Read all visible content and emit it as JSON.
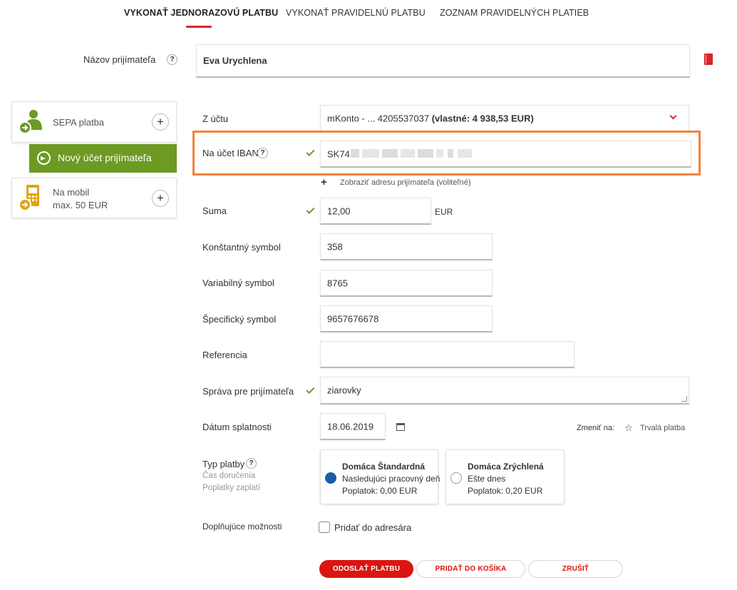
{
  "tabs": [
    {
      "label": "VYKONAŤ JEDNORAZOVÚ PLATBU",
      "active": true
    },
    {
      "label": "VYKONAŤ PRAVIDELNÚ PLATBU",
      "active": false
    },
    {
      "label": "ZOZNAM PRAVIDELNÝCH PLATIEB",
      "active": false
    }
  ],
  "recipient": {
    "label": "Názov prijímateľa",
    "value": "Eva Urychlena",
    "help": "?"
  },
  "sidebar": {
    "sepa": {
      "label": "SEPA platba",
      "icon": "person-payment-icon"
    },
    "new_account": {
      "label": "Nový účet prijímateľa"
    },
    "mobile": {
      "line1": "Na mobil",
      "line2": "max. 50 EUR",
      "icon": "mobile-payment-icon"
    },
    "plus": "+"
  },
  "form": {
    "from_account": {
      "label": "Z účtu",
      "value_prefix": "mKonto - ... 4205537037 ",
      "value_bold": "(vlastné: 4 938,53 EUR)"
    },
    "iban": {
      "label": "Na účet IBAN",
      "value": "SK74"
    },
    "show_address": {
      "plus": "+",
      "label": "Zobraziť adresu prijímateľa (voliteľné)"
    },
    "amount": {
      "label": "Suma",
      "value": "12,00",
      "currency": "EUR"
    },
    "constant_symbol": {
      "label": "Konštantný symbol",
      "value": "358"
    },
    "variable_symbol": {
      "label": "Variabilný symbol",
      "value": "8765"
    },
    "specific_symbol": {
      "label": "Špecifický symbol",
      "value": "9657676678"
    },
    "reference": {
      "label": "Referencia",
      "value": ""
    },
    "message": {
      "label": "Správa pre prijímateľa",
      "value": "ziarovky"
    },
    "due_date": {
      "label": "Dátum splatnosti",
      "value": "18.06.2019"
    },
    "change_to": {
      "label": "Zmeniť na:",
      "option": "Trvalá platba"
    },
    "payment_type": {
      "label": "Typ platby",
      "sub1": "Čas doručenia",
      "sub2": "Poplatky zaplatí",
      "options": [
        {
          "title": "Domáca Štandardná",
          "line2": "Nasledujúci pracovný deň",
          "line3": "Poplatok: 0,00 EUR",
          "selected": true
        },
        {
          "title": "Domáca Zrýchlená",
          "line2": "Ešte dnes",
          "line3": "Poplatok: 0,20 EUR",
          "selected": false
        }
      ]
    },
    "extra": {
      "label": "Doplňujúce možnosti",
      "checkbox_label": "Pridať do adresára"
    }
  },
  "buttons": {
    "send": "ODOSLAŤ PLATBU",
    "add_cart": "PRIDAŤ DO KOŠÍKA",
    "cancel": "ZRUŠIŤ"
  },
  "colors": {
    "accent_red": "#d9262c",
    "green": "#6c9a22",
    "highlight_orange": "#f0843a",
    "radio_blue": "#1a5ea8"
  }
}
